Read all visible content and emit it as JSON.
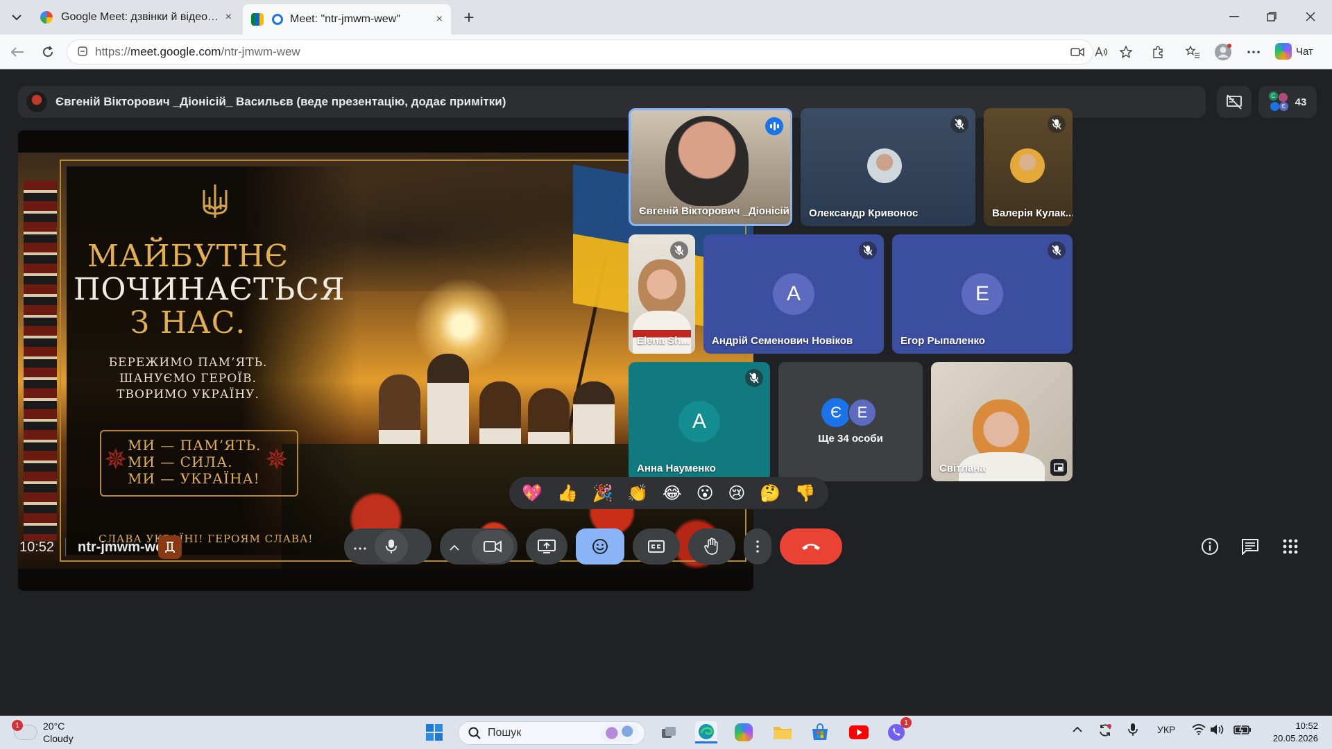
{
  "browser": {
    "tabs": [
      {
        "title": "Google Meet: дзвінки й відеоконф",
        "close": "×"
      },
      {
        "title": "Meet: \"ntr-jmwm-wew\"",
        "close": "×"
      }
    ],
    "new_tab": "+",
    "url_prefix": "https://",
    "url_host": "meet.google.com",
    "url_path": "/ntr-jmwm-wew",
    "chat_label": "Чат"
  },
  "meet": {
    "presenter_text": "Євгеній Вікторович _Діонісій_ Васильєв (веде презентацію, додає примітки)",
    "participants_count": "43",
    "slide": {
      "headline": [
        "МАЙБУТНЄ",
        "ПОЧИНАЄТЬСЯ",
        "З НАС."
      ],
      "subline": [
        "БЕРЕЖИМО ПАМ’ЯТЬ.",
        "ШАНУЄМО ГЕРОЇВ.",
        "ТВОРИМО УКРАЇНУ."
      ],
      "motto": [
        "МИ — ПАМ’ЯТЬ.",
        "МИ — СИЛА.",
        "МИ — УКРАЇНА!"
      ],
      "glory": "СЛАВА УКРАЇНІ!   ГЕРОЯМ СЛАВА!"
    },
    "tiles": [
      {
        "name": "Євгеній Вікторович _Діонісій_ Ва..."
      },
      {
        "name": "Олександр Кривонос"
      },
      {
        "name": "Валерія Кулак..."
      },
      {
        "name": "Elena Sh..."
      },
      {
        "name": "Андрій Семенович Новіков",
        "letter": "А"
      },
      {
        "name": "Егор Рыпаленко",
        "letter": "Е"
      },
      {
        "name": "Анна Науменко",
        "letter": "А"
      },
      {
        "name": "Ще 34 особи",
        "letters": [
          "Є",
          "Е"
        ]
      },
      {
        "name": "Світлана"
      }
    ],
    "reactions": [
      "💖",
      "👍",
      "🎉",
      "👏",
      "😂",
      "😮",
      "😢",
      "🤔",
      "👎"
    ],
    "clock": "10:52",
    "meeting_code": "ntr-jmwm-wew",
    "colors": {
      "accent": "#8ab4f8",
      "hangup": "#ea4335",
      "tile_blue": "#3c4e9f",
      "tile_teal": "#117a7e",
      "avatar_blue": "#5c6bc0",
      "avatar_teal": "#138d90"
    }
  },
  "taskbar": {
    "temperature": "20°C",
    "condition": "Cloudy",
    "weather_badge": "1",
    "search_placeholder": "Пошук",
    "viber_badge": "1",
    "language": "УКР",
    "time": "10:52",
    "date": "20.05.2026"
  }
}
